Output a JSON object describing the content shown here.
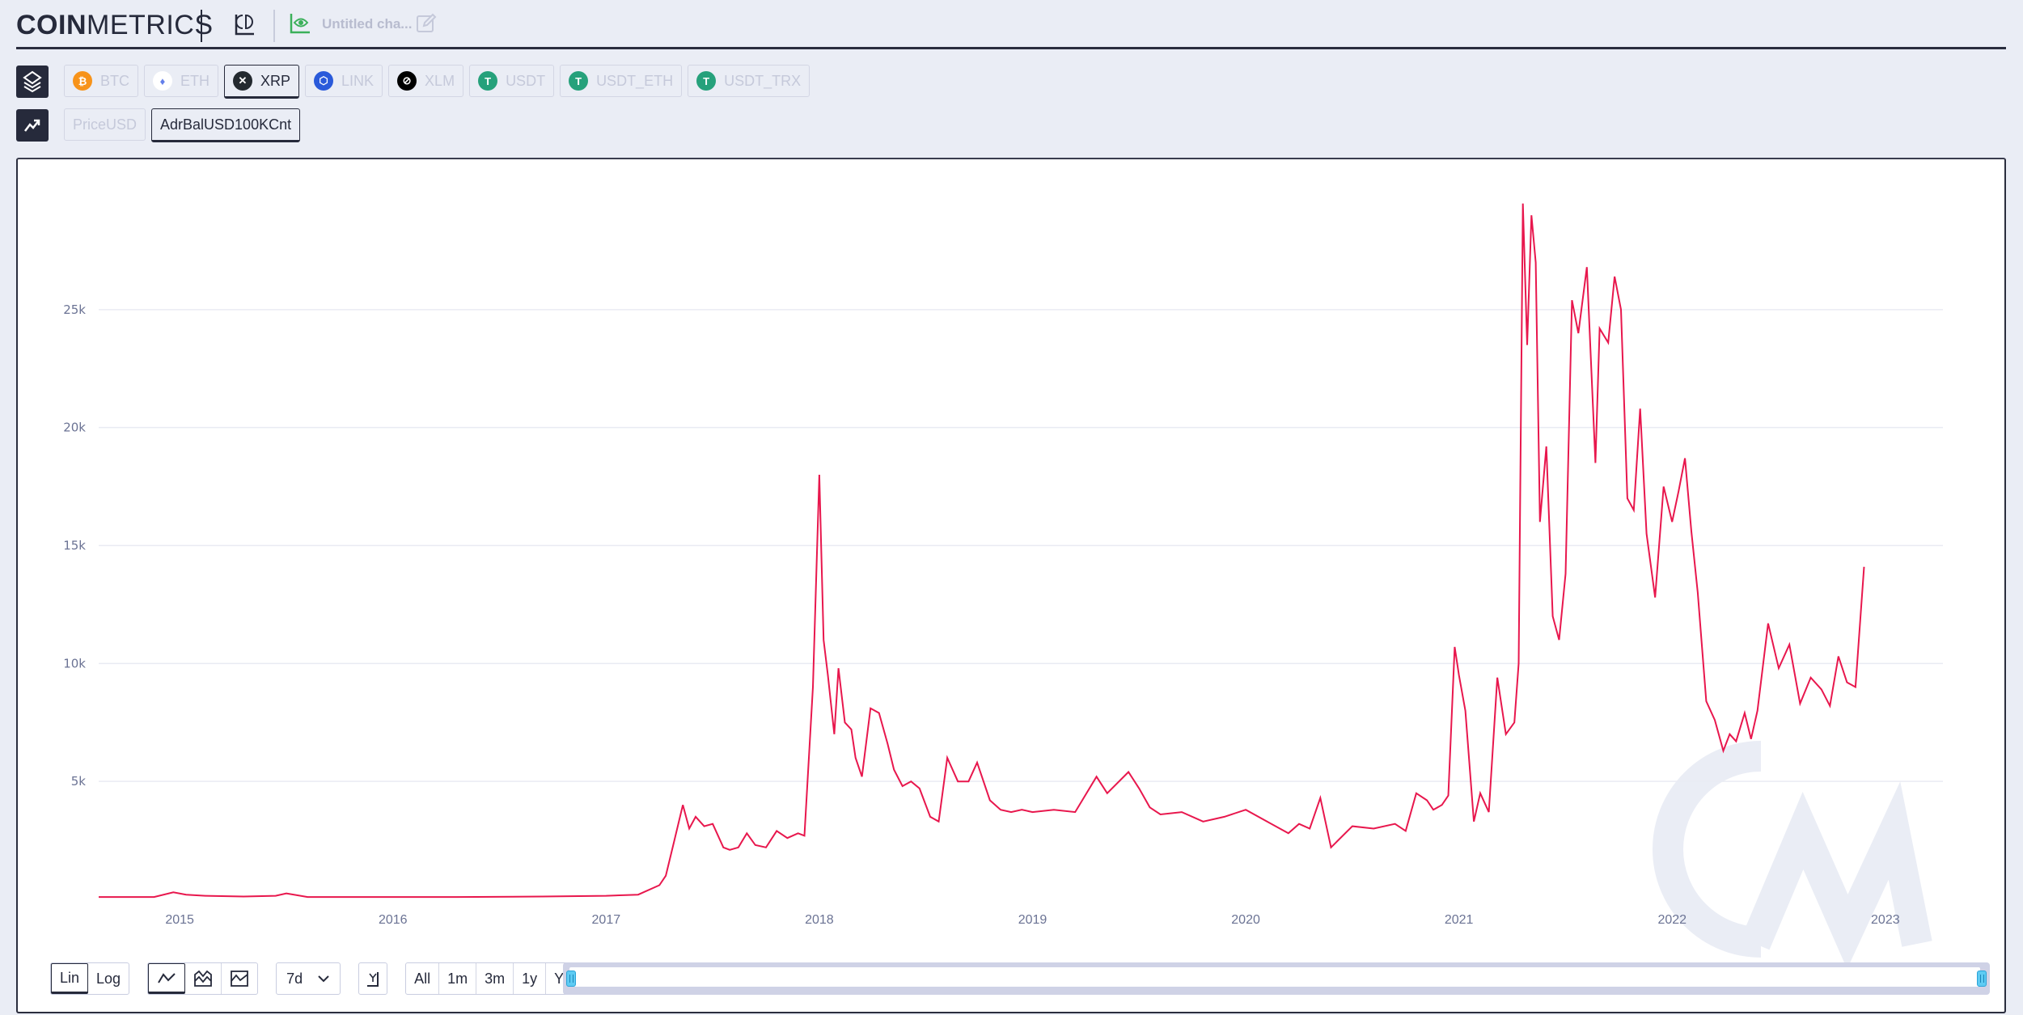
{
  "header": {
    "logo_bold": "COIN",
    "logo_light": "METRICS",
    "chart_title": "Untitled cha..."
  },
  "assets": [
    {
      "label": "BTC",
      "icon": "bitcoin-icon",
      "color": "#f7931a",
      "glyph": "₿",
      "active": false
    },
    {
      "label": "ETH",
      "icon": "ethereum-icon",
      "color": "#ffffff",
      "glyph": "♦",
      "active": false
    },
    {
      "label": "XRP",
      "icon": "xrp-icon",
      "color": "#23292f",
      "glyph": "✕",
      "active": true
    },
    {
      "label": "LINK",
      "icon": "chainlink-icon",
      "color": "#2a5ada",
      "glyph": "⬡",
      "active": false
    },
    {
      "label": "XLM",
      "icon": "stellar-icon",
      "color": "#000000",
      "glyph": "⊘",
      "active": false
    },
    {
      "label": "USDT",
      "icon": "tether-icon",
      "color": "#26a17b",
      "glyph": "T",
      "active": false
    },
    {
      "label": "USDT_ETH",
      "icon": "tether-icon",
      "color": "#26a17b",
      "glyph": "T",
      "active": false
    },
    {
      "label": "USDT_TRX",
      "icon": "tether-icon",
      "color": "#26a17b",
      "glyph": "T",
      "active": false
    }
  ],
  "metrics": [
    {
      "label": "PriceUSD",
      "active": false
    },
    {
      "label": "AdrBalUSD100KCnt",
      "active": true
    }
  ],
  "controls": {
    "scale": [
      "Lin",
      "Log"
    ],
    "scale_selected": "Lin",
    "chart_types": [
      "line-chart",
      "area-stacked-chart",
      "area-chart"
    ],
    "smoothing": "7d",
    "ranges": [
      "All",
      "1m",
      "3m",
      "1y",
      "YTD"
    ]
  },
  "colors": {
    "series": "#e8174d",
    "grid": "#e9ebf3",
    "axis_text": "#6b7394",
    "watermark": "#e8ebf3"
  },
  "chart_data": {
    "type": "line",
    "title": "",
    "xlabel": "",
    "ylabel": "",
    "xlim": [
      2014.62,
      2023.27
    ],
    "ylim": [
      0,
      30000
    ],
    "grid": true,
    "legend": "none",
    "x_ticks": [
      2015,
      2016,
      2017,
      2018,
      2019,
      2020,
      2021,
      2022,
      2023
    ],
    "y_ticks": [
      5000,
      10000,
      15000,
      20000,
      25000
    ],
    "y_tick_labels": [
      "5k",
      "10k",
      "15k",
      "20k",
      "25k"
    ],
    "series": [
      {
        "name": "XRP AdrBalUSD100KCnt",
        "x": [
          2014.62,
          2014.88,
          2014.97,
          2015.03,
          2015.12,
          2015.3,
          2015.45,
          2015.5,
          2015.6,
          2015.9,
          2016.3,
          2016.7,
          2017.0,
          2017.15,
          2017.25,
          2017.28,
          2017.32,
          2017.36,
          2017.39,
          2017.42,
          2017.46,
          2017.5,
          2017.55,
          2017.58,
          2017.62,
          2017.66,
          2017.7,
          2017.75,
          2017.8,
          2017.85,
          2017.9,
          2017.93,
          2017.97,
          2018.0,
          2018.02,
          2018.04,
          2018.07,
          2018.09,
          2018.12,
          2018.15,
          2018.17,
          2018.2,
          2018.24,
          2018.28,
          2018.32,
          2018.35,
          2018.39,
          2018.43,
          2018.47,
          2018.52,
          2018.56,
          2018.6,
          2018.65,
          2018.7,
          2018.74,
          2018.8,
          2018.85,
          2018.9,
          2018.95,
          2019.0,
          2019.1,
          2019.2,
          2019.3,
          2019.35,
          2019.45,
          2019.5,
          2019.55,
          2019.6,
          2019.7,
          2019.8,
          2019.9,
          2020.0,
          2020.1,
          2020.2,
          2020.25,
          2020.3,
          2020.35,
          2020.4,
          2020.5,
          2020.6,
          2020.7,
          2020.75,
          2020.8,
          2020.85,
          2020.88,
          2020.92,
          2020.95,
          2020.98,
          2021.0,
          2021.03,
          2021.07,
          2021.1,
          2021.14,
          2021.18,
          2021.22,
          2021.26,
          2021.28,
          2021.3,
          2021.32,
          2021.34,
          2021.36,
          2021.38,
          2021.41,
          2021.44,
          2021.47,
          2021.5,
          2021.53,
          2021.56,
          2021.6,
          2021.64,
          2021.66,
          2021.7,
          2021.73,
          2021.76,
          2021.79,
          2021.82,
          2021.85,
          2021.88,
          2021.92,
          2021.96,
          2022.0,
          2022.03,
          2022.06,
          2022.09,
          2022.12,
          2022.16,
          2022.2,
          2022.24,
          2022.27,
          2022.3,
          2022.34,
          2022.37,
          2022.4,
          2022.45,
          2022.5,
          2022.55,
          2022.6,
          2022.65,
          2022.7,
          2022.74,
          2022.78,
          2022.82,
          2022.86,
          2022.9,
          2022.95,
          2023.0,
          2023.05,
          2023.1,
          2023.15,
          2023.2,
          2023.24,
          2023.27
        ],
        "values": [
          100,
          100,
          300,
          200,
          150,
          120,
          150,
          250,
          100,
          100,
          100,
          120,
          150,
          200,
          600,
          1000,
          2500,
          4000,
          3000,
          3500,
          3100,
          3200,
          2200,
          2100,
          2200,
          2800,
          2300,
          2200,
          2900,
          2600,
          2800,
          2700,
          9000,
          18000,
          11000,
          9500,
          7000,
          9800,
          7500,
          7200,
          6000,
          5200,
          8100,
          7900,
          6600,
          5500,
          4800,
          5000,
          4700,
          3500,
          3300,
          6000,
          5000,
          5000,
          5800,
          4200,
          3800,
          3700,
          3800,
          3700,
          3800,
          3700,
          5200,
          4500,
          5400,
          4700,
          3900,
          3600,
          3700,
          3300,
          3500,
          3800,
          3300,
          2800,
          3200,
          3000,
          4300,
          2200,
          3100,
          3000,
          3200,
          2900,
          4500,
          4200,
          3800,
          4000,
          4400,
          10700,
          9500,
          8000,
          3300,
          4500,
          3700,
          9400,
          7000,
          7500,
          10000,
          29500,
          23500,
          29000,
          27000,
          16000,
          19200,
          12000,
          11000,
          13800,
          25400,
          24000,
          26800,
          18500,
          24200,
          23600,
          26400,
          25000,
          17000,
          16500,
          20800,
          15500,
          12800,
          17500,
          16000,
          17300,
          18700,
          15600,
          13000,
          8400,
          7600,
          6300,
          7000,
          6700,
          7900,
          6800,
          8000,
          11700,
          9800,
          10800,
          8300,
          9400,
          8900,
          8200,
          10300,
          9200,
          9000,
          14100
        ]
      }
    ]
  }
}
